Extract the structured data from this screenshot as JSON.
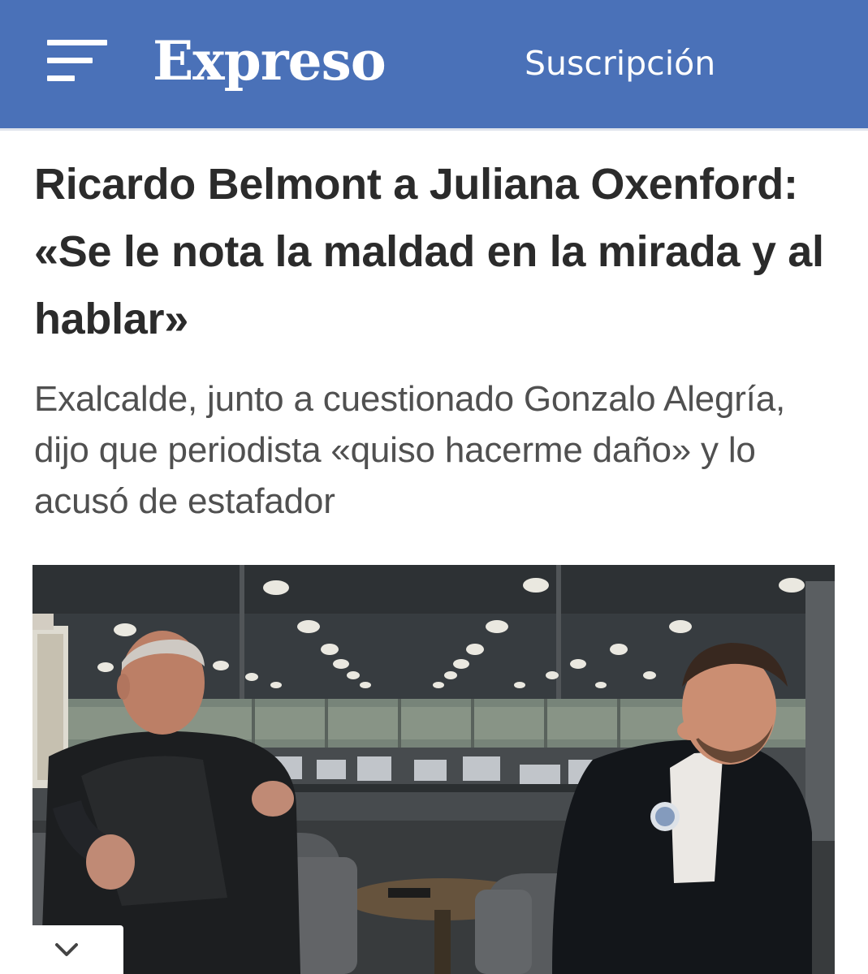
{
  "header": {
    "logo_text": "Expreso",
    "subscription_label": "Suscripción",
    "menu_icon": "hamburger-menu-icon",
    "background_color": "#4a71b8"
  },
  "article": {
    "headline": "Ricardo Belmont a Juliana Oxenford: «Se le nota la maldad en la mirada y al hablar»",
    "subheadline": "Exalcalde, junto a cuestionado Gonzalo Alegría, dijo que periodista «quiso hacerme daño» y lo acusó de estafador"
  },
  "media": {
    "expand_icon": "chevron-down-icon"
  }
}
